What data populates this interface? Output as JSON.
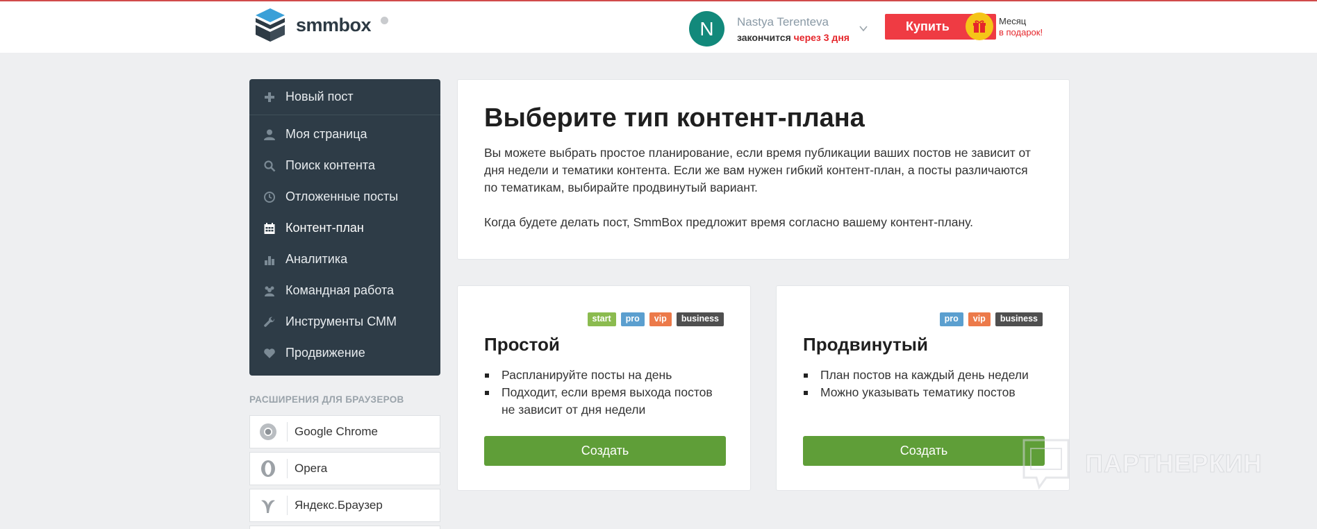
{
  "header": {
    "logo_text": "smmbox",
    "user_initial": "N",
    "user_name": "Nastya Terenteva",
    "expires_prefix": "закончится",
    "expires_value": "через 3 дня",
    "buy_label": "Купить",
    "promo_line1": "Месяц",
    "promo_line2": "в подарок!"
  },
  "sidebar": {
    "items": [
      {
        "label": "Новый пост",
        "icon": "plus-icon"
      },
      {
        "label": "Моя страница",
        "icon": "user-icon"
      },
      {
        "label": "Поиск контента",
        "icon": "search-icon"
      },
      {
        "label": "Отложенные посты",
        "icon": "clock-icon"
      },
      {
        "label": "Контент-план",
        "icon": "calendar-icon",
        "active": true
      },
      {
        "label": "Аналитика",
        "icon": "bar-chart-icon"
      },
      {
        "label": "Командная работа",
        "icon": "team-icon"
      },
      {
        "label": "Инструменты СММ",
        "icon": "wrench-icon"
      },
      {
        "label": "Продвижение",
        "icon": "heart-icon"
      }
    ],
    "extensions_title": "РАСШИРЕНИЯ ДЛЯ БРАУЗЕРОВ",
    "extensions": [
      {
        "label": "Google Chrome",
        "icon": "chrome-icon"
      },
      {
        "label": "Opera",
        "icon": "opera-icon"
      },
      {
        "label": "Яндекс.Браузер",
        "icon": "yandex-browser-icon"
      }
    ]
  },
  "intro": {
    "title": "Выберите тип контент-плана",
    "paragraph1": "Вы можете выбрать простое планирование, если время публикации ваших постов не зависит от дня недели и тематики контента. Если же вам нужен гибкий контент-план, а посты различаются по тематикам, выбирайте продвинутый вариант.",
    "paragraph2": "Когда будете делать пост, SmmBox предложит время согласно вашему контент-плану."
  },
  "plans": [
    {
      "title": "Простой",
      "badges": [
        "start",
        "pro",
        "vip",
        "business"
      ],
      "bullets": [
        "Распланируйте посты на день",
        "Подходит, если время выхода постов не зависит от дня недели"
      ],
      "button": "Создать"
    },
    {
      "title": "Продвинутый",
      "badges": [
        "pro",
        "vip",
        "business"
      ],
      "bullets": [
        "План постов на каждый день недели",
        "Можно указывать тематику постов"
      ],
      "button": "Создать"
    }
  ],
  "badge_colors": {
    "start": "#8bbb4f",
    "pro": "#5b9fcf",
    "vip": "#ec7a4a",
    "business": "#4f4f4f"
  },
  "watermark": "ПАРТНЕРКИН",
  "colors": {
    "sidebar_bg": "#2e3c47",
    "buy": "#ef3b43",
    "create": "#5f9e38",
    "avatar": "#12897b"
  }
}
